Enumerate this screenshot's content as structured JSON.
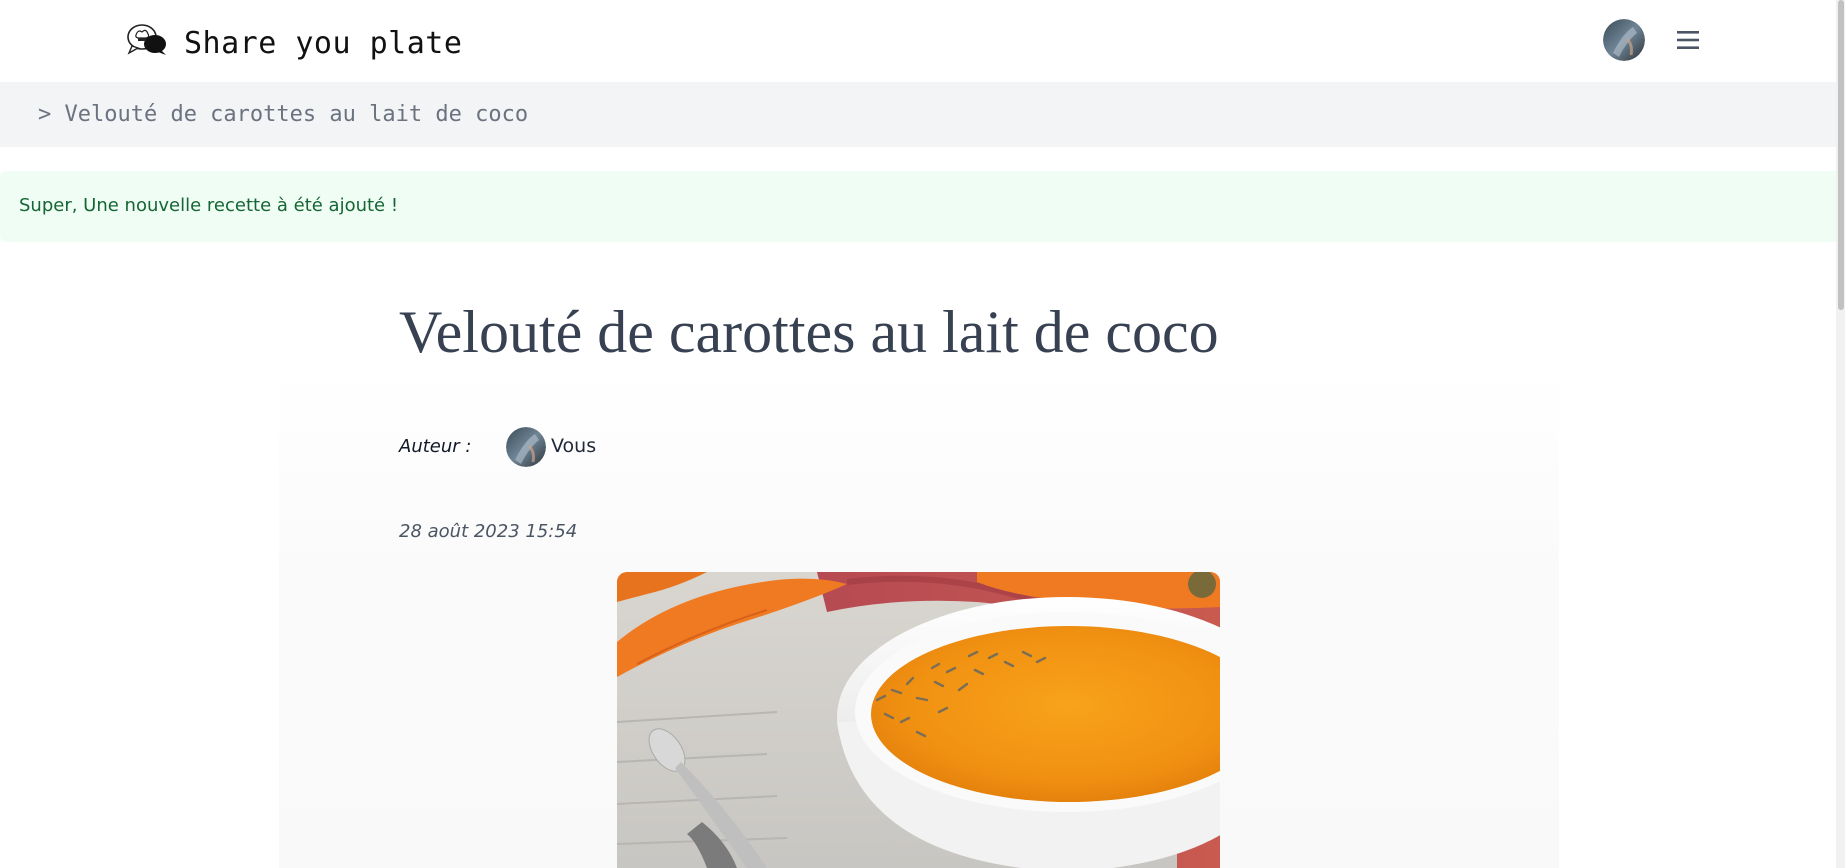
{
  "header": {
    "site_title": "Share you plate",
    "logo_icon": "chef-chat-bubble-icon",
    "menu_icon": "hamburger-menu-icon"
  },
  "breadcrumb": {
    "text": "> Velouté de carottes au lait de coco"
  },
  "alert": {
    "message": "Super, Une nouvelle recette à été ajouté !",
    "color": "#166534",
    "background": "#f0fdf4"
  },
  "recipe": {
    "title": "Velouté de carottes au lait de coco",
    "author_label": "Auteur :",
    "author_name": "Vous",
    "date": "28 août 2023 15:54",
    "image_alt": "carrot-soup-bowl-photo"
  }
}
